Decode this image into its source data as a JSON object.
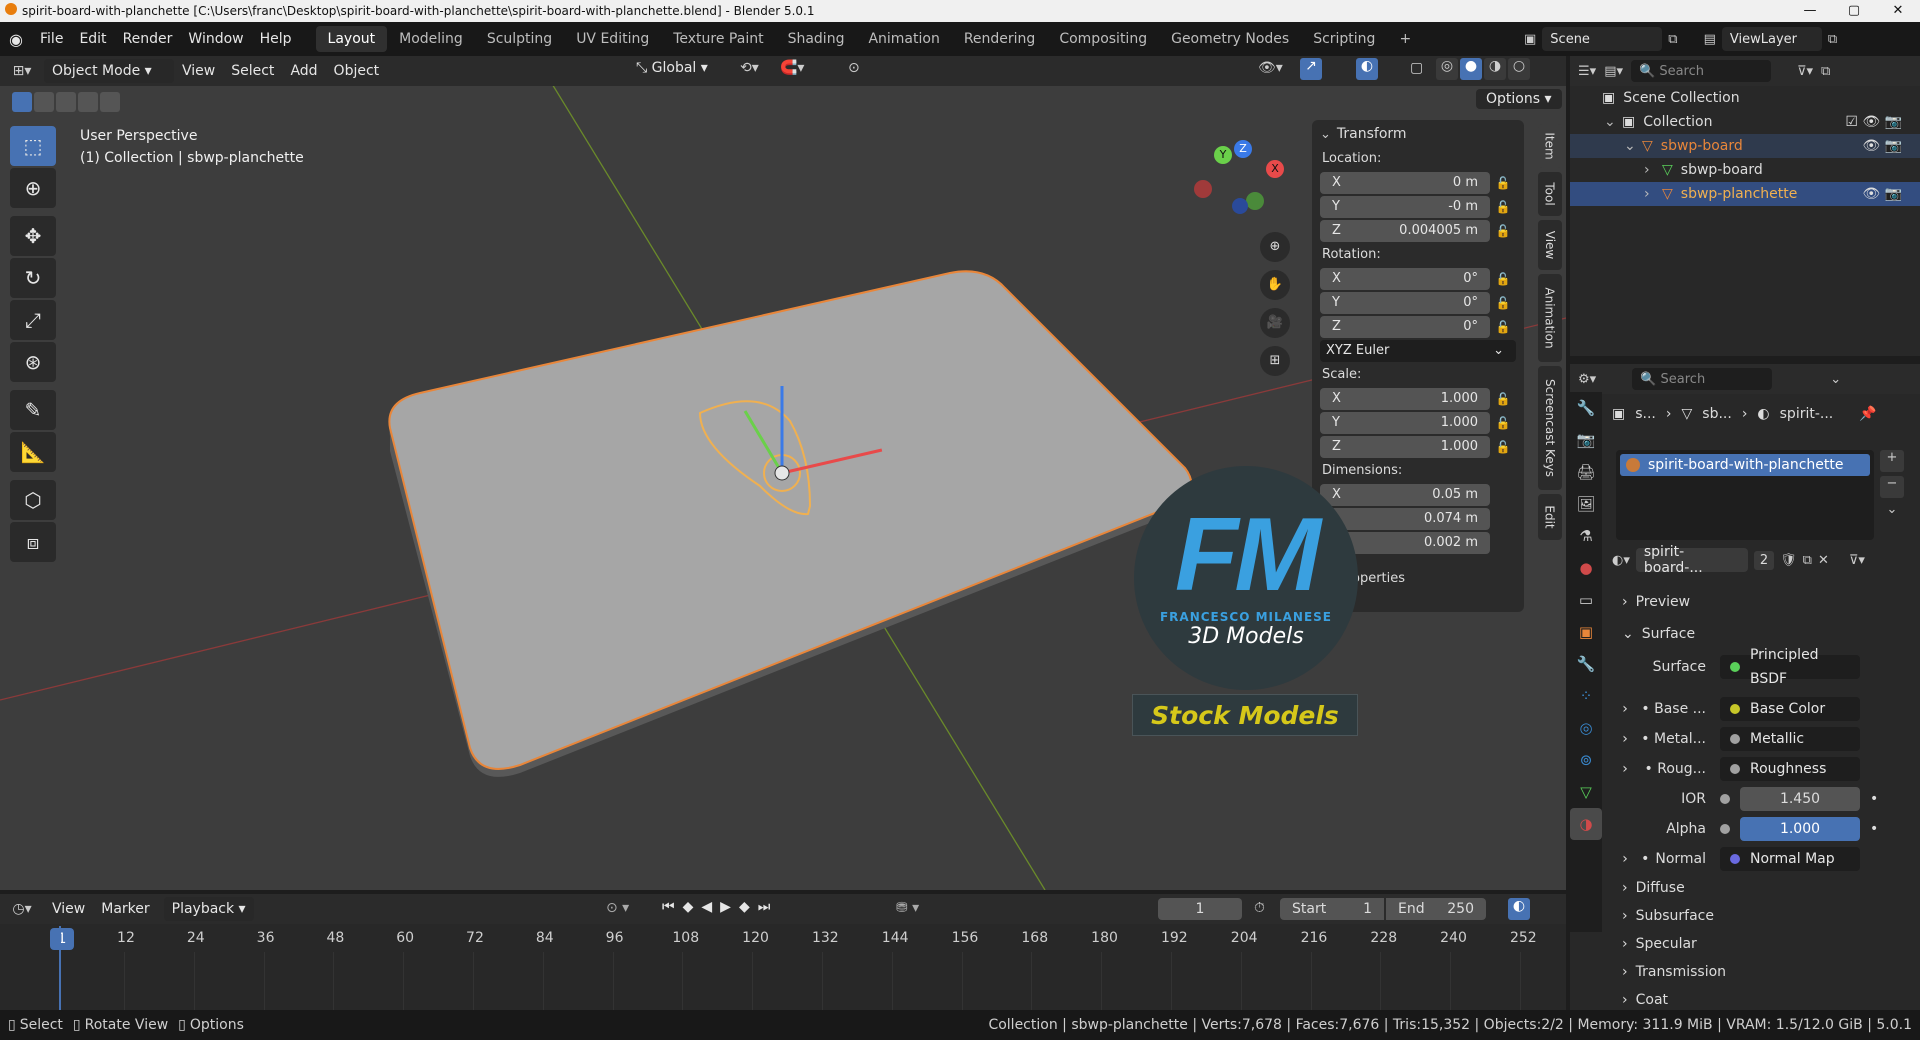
{
  "window": {
    "title": "spirit-board-with-planchette [C:\\Users\\franc\\Desktop\\spirit-board-with-planchette\\spirit-board-with-planchette.blend] - Blender 5.0.1",
    "controls": [
      "—",
      "▢",
      "✕"
    ]
  },
  "menu": [
    "File",
    "Edit",
    "Render",
    "Window",
    "Help"
  ],
  "workspaces": [
    "Layout",
    "Modeling",
    "Sculpting",
    "UV Editing",
    "Texture Paint",
    "Shading",
    "Animation",
    "Rendering",
    "Compositing",
    "Geometry Nodes",
    "Scripting",
    "+"
  ],
  "scene": {
    "name": "Scene",
    "view_layer": "ViewLayer"
  },
  "viewport_header": {
    "mode": "Object Mode",
    "menus": [
      "View",
      "Select",
      "Add",
      "Object"
    ],
    "orientation": "Global",
    "options": "Options"
  },
  "viewport": {
    "perspective": "User Perspective",
    "context": "(1) Collection | sbwp-planchette"
  },
  "npanel": {
    "title": "Transform",
    "location_label": "Location:",
    "location": [
      {
        "axis": "X",
        "value": "0 m"
      },
      {
        "axis": "Y",
        "value": "-0 m"
      },
      {
        "axis": "Z",
        "value": "0.004005 m"
      }
    ],
    "rotation_label": "Rotation:",
    "rotation": [
      {
        "axis": "X",
        "value": "0°"
      },
      {
        "axis": "Y",
        "value": "0°"
      },
      {
        "axis": "Z",
        "value": "0°"
      }
    ],
    "rotation_mode": "XYZ Euler",
    "scale_label": "Scale:",
    "scale": [
      {
        "axis": "X",
        "value": "1.000"
      },
      {
        "axis": "Y",
        "value": "1.000"
      },
      {
        "axis": "Z",
        "value": "1.000"
      }
    ],
    "dimensions_label": "Dimensions:",
    "dimensions": [
      {
        "axis": "X",
        "value": "0.05 m"
      },
      {
        "axis": "",
        "value": "0.074 m"
      },
      {
        "axis": "",
        "value": "0.002 m"
      }
    ],
    "properties": "operties"
  },
  "side_tabs": [
    "Item",
    "Tool",
    "View",
    "Animation",
    "Screencast Keys",
    "Edit"
  ],
  "watermark": {
    "initials": "FM",
    "author": "FRANCESCO MILANESE",
    "subtitle": "3D Models",
    "banner": "Stock Models"
  },
  "outliner": {
    "search_placeholder": "Search",
    "rows": [
      {
        "label": "Scene Collection",
        "indent": 0,
        "selected": false,
        "color": "#dcdcdc"
      },
      {
        "label": "Collection",
        "indent": 1,
        "selected": false,
        "color": "#dcdcdc"
      },
      {
        "label": "sbwp-board",
        "indent": 2,
        "selected": false,
        "color": "#e8863a"
      },
      {
        "label": "sbwp-board",
        "indent": 3,
        "selected": false,
        "color": "#dcdcdc"
      },
      {
        "label": "sbwp-planchette",
        "indent": 3,
        "selected": true,
        "color": "#f0b050"
      }
    ]
  },
  "properties": {
    "search_placeholder": "Search",
    "breadcrumb": [
      "s...",
      "sb...",
      "spirit-..."
    ],
    "material_slot": "spirit-board-with-planchette",
    "material_name": "spirit-board-...",
    "users": "2",
    "sections": {
      "preview": "Preview",
      "surface": "Surface"
    },
    "surface_label": "Surface",
    "surface_value": "Principled BSDF",
    "inputs": [
      {
        "label": "Base ...",
        "value": "Base Color",
        "sock": "#c7c729",
        "expand": true
      },
      {
        "label": "Metal...",
        "value": "Metallic",
        "sock": "#a1a1a1",
        "expand": true
      },
      {
        "label": "Roug...",
        "value": "Roughness",
        "sock": "#a1a1a1",
        "expand": true
      }
    ],
    "ior_label": "IOR",
    "ior": "1.450",
    "alpha_label": "Alpha",
    "alpha": "1.000",
    "normal_label": "Normal",
    "normal_value": "Normal Map",
    "subsections": [
      "Diffuse",
      "Subsurface",
      "Specular",
      "Transmission",
      "Coat"
    ]
  },
  "timeline": {
    "menus": [
      "View",
      "Marker",
      "Playback"
    ],
    "current_frame": "1",
    "start_label": "Start",
    "start": "1",
    "end_label": "End",
    "end": "250",
    "ticks": [
      "1",
      "12",
      "24",
      "36",
      "48",
      "60",
      "72",
      "84",
      "96",
      "108",
      "120",
      "132",
      "144",
      "156",
      "168",
      "180",
      "192",
      "204",
      "216",
      "228",
      "240",
      "252"
    ]
  },
  "statusbar": {
    "left": [
      "Select",
      "Rotate View",
      "Options"
    ],
    "right": "Collection | sbwp-planchette | Verts:7,678 | Faces:7,676 | Tris:15,352 | Objects:2/2 | Memory: 311.9 MiB | VRAM: 1.5/12.0 GiB | 5.0.1"
  },
  "colors": {
    "accent": "#4772b3",
    "selection": "#e8863a",
    "viewport_bg": "#3d3d3d"
  }
}
